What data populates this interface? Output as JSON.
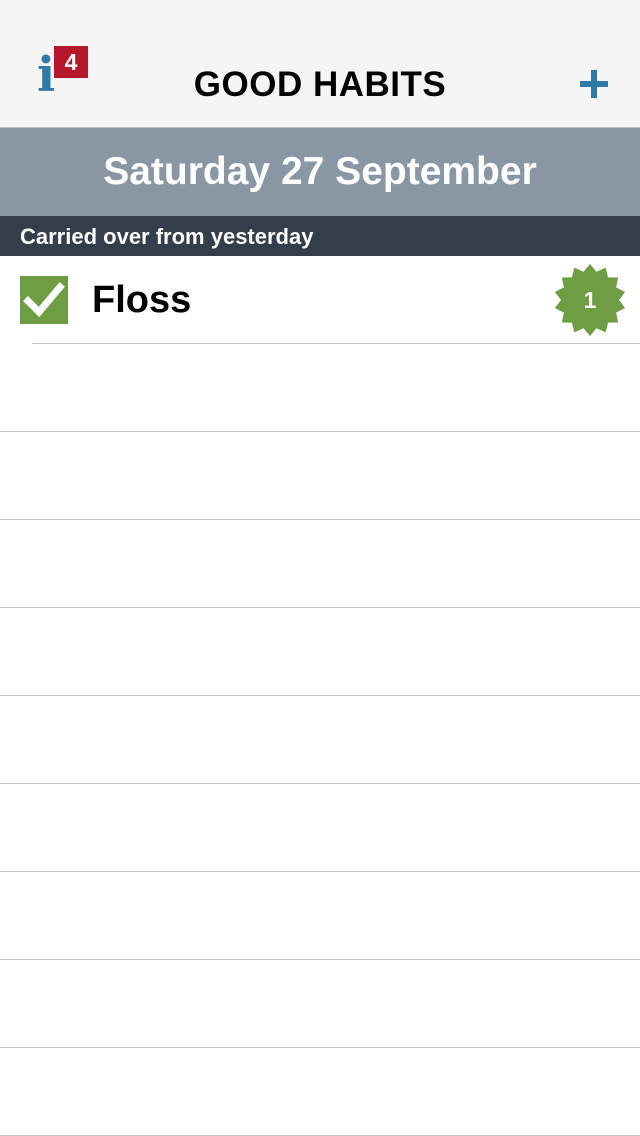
{
  "navbar": {
    "title": "GOOD HABITS",
    "info_badge_count": "4",
    "info_icon": "info-icon",
    "add_icon": "plus-icon"
  },
  "date_header": {
    "text": "Saturday 27 September"
  },
  "section": {
    "title": "Carried over from yesterday"
  },
  "habits": [
    {
      "name": "Floss",
      "checked": true,
      "streak": "1"
    }
  ],
  "colors": {
    "accent_blue": "#2f79a6",
    "badge_red": "#b5182b",
    "check_green": "#6f9d43",
    "date_header_bg": "#8996a3",
    "section_header_bg": "#343e4a"
  }
}
